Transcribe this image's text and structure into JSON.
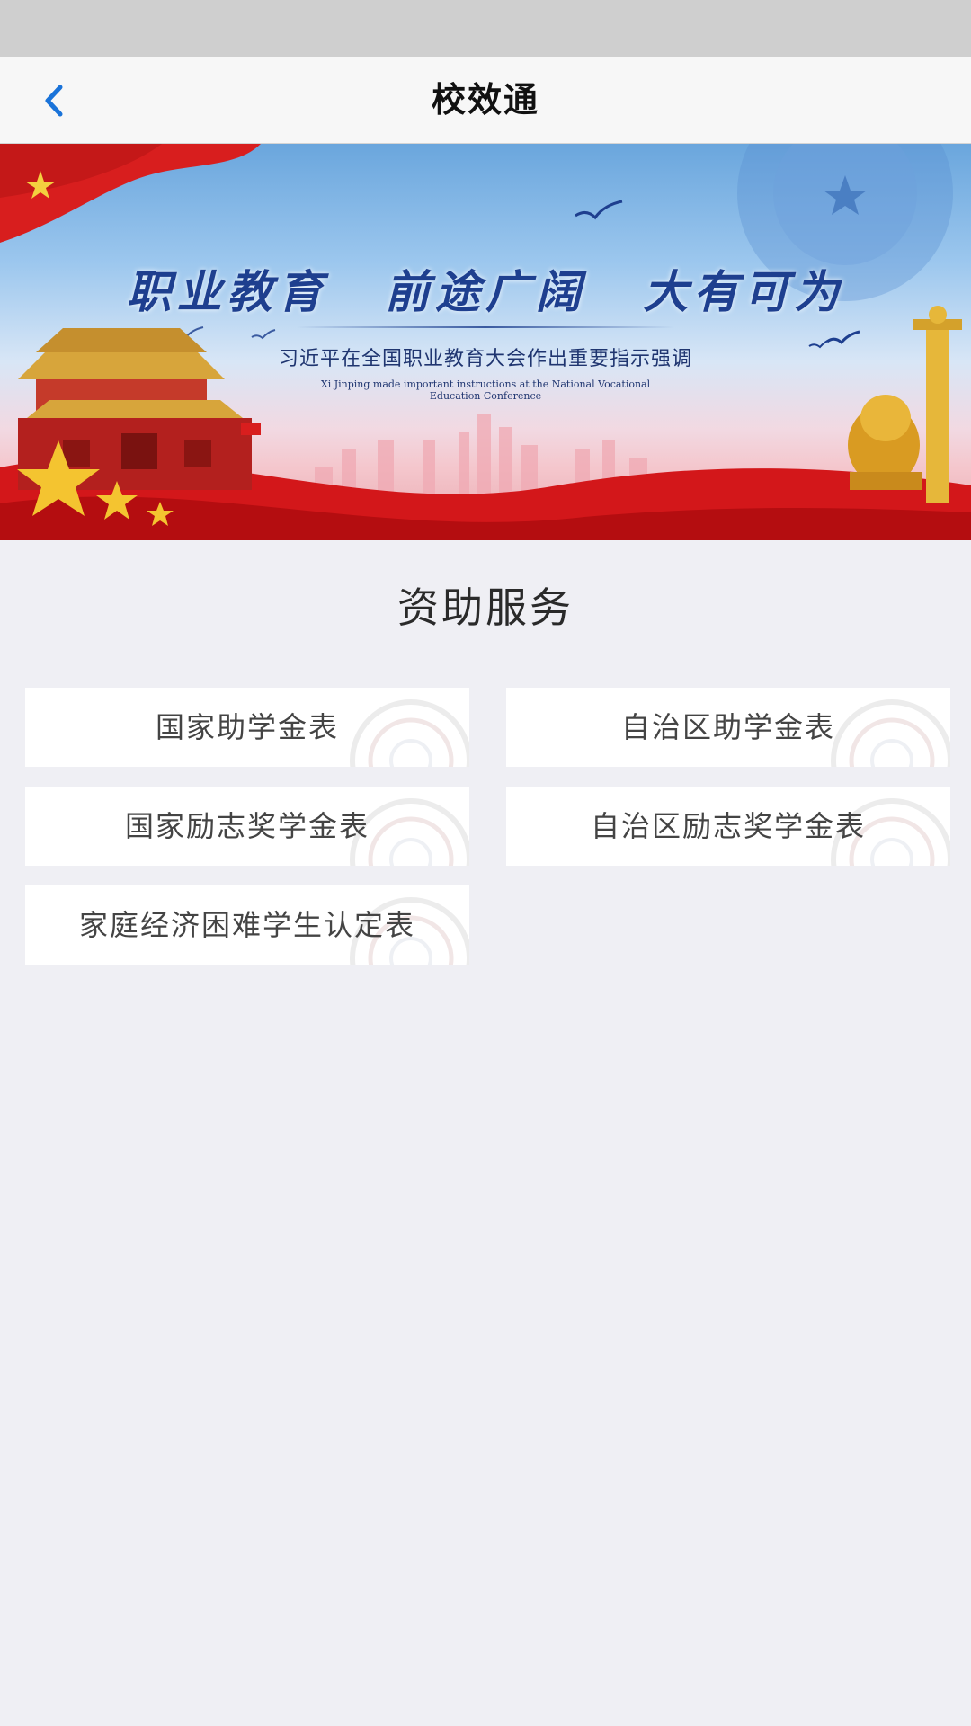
{
  "nav": {
    "title": "校效通",
    "back_icon": "chevron-left-icon",
    "accent_color": "#1a73d9"
  },
  "banner": {
    "headline": "职业教育  前途广阔  大有可为",
    "subtitle_cn": "习近平在全国职业教育大会作出重要指示强调",
    "subtitle_en": "Xi Jinping made important instructions at the National Vocational Education Conference"
  },
  "section": {
    "title": "资助服务"
  },
  "items": [
    {
      "label": "国家助学金表"
    },
    {
      "label": "自治区助学金表"
    },
    {
      "label": "国家励志奖学金表"
    },
    {
      "label": "自治区励志奖学金表"
    },
    {
      "label": "家庭经济困难学生认定表"
    }
  ]
}
